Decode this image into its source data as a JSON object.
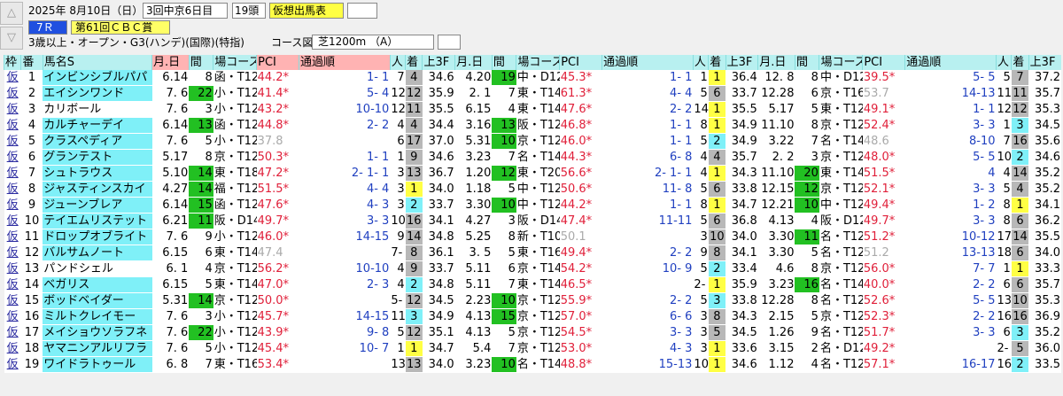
{
  "header": {
    "date": "2025年  8月10日（日）",
    "meeting": "3回中京6日目",
    "heads": "19頭",
    "mode_button": "仮想出馬表",
    "race_no": "7Ｒ",
    "race_title": "第61回ＣＢＣ賞",
    "race_cond": "3歳以上・オープン・G3(ハンデ)(国際)(特指)",
    "course_label": "コース図",
    "course": "芝1200m （A）"
  },
  "columns": {
    "waku": "枠",
    "ban": "番",
    "name": "馬名S",
    "groups": [
      {
        "md": "月.日",
        "kan": "間",
        "jo": "場コース",
        "pci": "PCI",
        "tsuka": "通過順",
        "nin": "人",
        "chaku": "着",
        "agari": "上3F"
      },
      {
        "md": "月.日",
        "kan": "間",
        "jo": "場コース",
        "pci": "PCI",
        "tsuka": "通過順",
        "nin": "人",
        "chaku": "着",
        "agari": "上3F"
      },
      {
        "md": "月.日",
        "kan": "間",
        "jo": "場コース",
        "pci": "PCI",
        "tsuka": "通過順",
        "nin": "人",
        "chaku": "着",
        "agari": "上3F"
      }
    ]
  },
  "rows": [
    {
      "waku": "仮",
      "ban": "1",
      "name": "インビンシブルパパ",
      "r": [
        [
          "6.14",
          "8",
          "函・T12",
          "44.2*",
          "1- 1",
          "7",
          "4",
          "34.6"
        ],
        [
          "4.20",
          "19",
          "中・D12",
          "45.3*",
          "1- 1",
          "1",
          "1",
          "36.4"
        ],
        [
          "12. 8",
          "8",
          "中・D12",
          "39.5*",
          "5- 5",
          "5",
          "7",
          "37.2"
        ]
      ]
    },
    {
      "waku": "仮",
      "ban": "2",
      "name": "エイシンワンド",
      "r": [
        [
          "7. 6",
          "22",
          "小・T12",
          "41.4*",
          "5- 4",
          "12",
          "12",
          "35.9"
        ],
        [
          "2. 1",
          "7",
          "東・T14",
          "61.3*",
          "4- 4",
          "5",
          "6",
          "33.7"
        ],
        [
          "12.28",
          "6",
          "京・T16",
          "53.7",
          "14-13",
          "11",
          "11",
          "35.7"
        ]
      ]
    },
    {
      "waku": "仮",
      "ban": "3",
      "name": "カリボール",
      "r": [
        [
          "7. 6",
          "3",
          "小・T12",
          "43.2*",
          "10-10",
          "12",
          "11",
          "35.5"
        ],
        [
          "6.15",
          "4",
          "東・T14",
          "47.6*",
          "2- 2",
          "14",
          "1",
          "35.5"
        ],
        [
          "5.17",
          "5",
          "東・T12",
          "49.1*",
          "1- 1",
          "12",
          "12",
          "35.3"
        ]
      ]
    },
    {
      "waku": "仮",
      "ban": "4",
      "name": "カルチャーデイ",
      "r": [
        [
          "6.14",
          "13",
          "函・T12",
          "44.8*",
          "2- 2",
          "4",
          "4",
          "34.4"
        ],
        [
          "3.16",
          "13",
          "阪・T12",
          "46.8*",
          "1- 1",
          "8",
          "1",
          "34.9"
        ],
        [
          "11.10",
          "8",
          "京・T12",
          "52.4*",
          "3- 3",
          "1",
          "3",
          "34.5"
        ]
      ]
    },
    {
      "waku": "仮",
      "ban": "5",
      "name": "クラスペディア",
      "r": [
        [
          "7. 6",
          "5",
          "小・T12",
          "37.8",
          "6",
          "17",
          "37.0"
        ],
        [
          "5.31",
          "10",
          "京・T12",
          "46.0*",
          "1- 1",
          "5",
          "2",
          "34.9"
        ],
        [
          "3.22",
          "7",
          "名・T14",
          "48.6",
          "8-10",
          "7",
          "16",
          "35.6"
        ]
      ]
    },
    {
      "waku": "仮",
      "ban": "6",
      "name": "グランテスト",
      "r": [
        [
          "5.17",
          "8",
          "京・T12",
          "50.3*",
          "1- 1",
          "1",
          "9",
          "34.6"
        ],
        [
          "3.23",
          "7",
          "名・T14",
          "44.3*",
          "6- 8",
          "4",
          "4",
          "35.7"
        ],
        [
          "2. 2",
          "3",
          "京・T12",
          "48.0*",
          "5- 5",
          "10",
          "2",
          "34.6"
        ]
      ]
    },
    {
      "waku": "仮",
      "ban": "7",
      "name": "シュトラウス",
      "r": [
        [
          "5.10",
          "14",
          "東・T18",
          "47.2*",
          "2- 1- 1",
          "3",
          "13",
          "36.7"
        ],
        [
          "1.20",
          "12",
          "東・T20",
          "56.6*",
          "2- 1- 1",
          "4",
          "1",
          "34.3"
        ],
        [
          "11.10",
          "20",
          "東・T14",
          "51.5*",
          "4",
          "4",
          "14",
          "35.2"
        ]
      ]
    },
    {
      "waku": "仮",
      "ban": "8",
      "name": "ジャスティンスカイ",
      "r": [
        [
          "4.27",
          "14",
          "福・T12",
          "51.5*",
          "4- 4",
          "3",
          "1",
          "34.0"
        ],
        [
          "1.18",
          "5",
          "中・T12",
          "50.6*",
          "11- 8",
          "5",
          "6",
          "33.8"
        ],
        [
          "12.15",
          "12",
          "京・T12",
          "52.1*",
          "3- 3",
          "5",
          "4",
          "35.2"
        ]
      ]
    },
    {
      "waku": "仮",
      "ban": "9",
      "name": "ジューンブレア",
      "r": [
        [
          "6.14",
          "15",
          "函・T12",
          "47.6*",
          "4- 3",
          "3",
          "2",
          "33.7"
        ],
        [
          "3.30",
          "10",
          "中・T12",
          "44.2*",
          "1- 1",
          "8",
          "1",
          "34.7"
        ],
        [
          "12.21",
          "10",
          "中・T12",
          "49.4*",
          "1- 2",
          "8",
          "1",
          "34.1"
        ]
      ]
    },
    {
      "waku": "仮",
      "ban": "10",
      "name": "テイエムリステット",
      "r": [
        [
          "6.21",
          "11",
          "阪・D14",
          "49.7*",
          "3- 3",
          "10",
          "16",
          "34.1"
        ],
        [
          "4.27",
          "3",
          "阪・D14",
          "47.4*",
          "11-11",
          "5",
          "6",
          "36.8"
        ],
        [
          "4.13",
          "4",
          "阪・D12",
          "49.7*",
          "3- 3",
          "8",
          "6",
          "36.2"
        ]
      ]
    },
    {
      "waku": "仮",
      "ban": "11",
      "name": "ドロップオブライト",
      "r": [
        [
          "7. 6",
          "9",
          "小・T12",
          "46.0*",
          "14-15",
          "9",
          "14",
          "34.8"
        ],
        [
          "5.25",
          "8",
          "新・T10",
          "50.1",
          "3",
          "10",
          "34.0"
        ],
        [
          "3.30",
          "11",
          "名・T12",
          "51.2*",
          "10-12",
          "17",
          "14",
          "35.5"
        ]
      ]
    },
    {
      "waku": "仮",
      "ban": "12",
      "name": "バルサムノート",
      "r": [
        [
          "6.15",
          "6",
          "東・T14",
          "47.4",
          "7- 7",
          "8",
          "36.1"
        ],
        [
          "3. 5",
          "5",
          "東・T16",
          "49.4*",
          "2- 2",
          "9",
          "8",
          "34.1"
        ],
        [
          "3.30",
          "5",
          "名・T12",
          "51.2",
          "13-13",
          "18",
          "6",
          "34.0"
        ]
      ]
    },
    {
      "waku": "仮",
      "ban": "13",
      "name": "パンドシェル",
      "r": [
        [
          "6. 1",
          "4",
          "京・T12",
          "56.2*",
          "10-10",
          "4",
          "9",
          "33.7"
        ],
        [
          "5.11",
          "6",
          "京・T14",
          "54.2*",
          "10- 9",
          "5",
          "2",
          "33.4"
        ],
        [
          "4.6",
          "8",
          "京・T12",
          "56.0*",
          "7- 7",
          "1",
          "1",
          "33.3"
        ]
      ]
    },
    {
      "waku": "仮",
      "ban": "14",
      "name": "ベガリス",
      "r": [
        [
          "6.15",
          "5",
          "東・T14",
          "47.0*",
          "2- 3",
          "4",
          "2",
          "34.8"
        ],
        [
          "5.11",
          "7",
          "東・T14",
          "46.5*",
          "2- 2",
          "1",
          "35.9"
        ],
        [
          "3.23",
          "16",
          "名・T14",
          "40.0*",
          "2- 2",
          "6",
          "6",
          "35.7"
        ]
      ]
    },
    {
      "waku": "仮",
      "ban": "15",
      "name": "ボッドベイダー",
      "r": [
        [
          "5.31",
          "14",
          "京・T12",
          "50.0*",
          "5- 5",
          "12",
          "34.5"
        ],
        [
          "2.23",
          "10",
          "京・T12",
          "55.9*",
          "2- 2",
          "5",
          "3",
          "33.8"
        ],
        [
          "12.28",
          "8",
          "名・T12",
          "52.6*",
          "5- 5",
          "13",
          "10",
          "35.3"
        ]
      ]
    },
    {
      "waku": "仮",
      "ban": "16",
      "name": "ミルトクレイモー",
      "r": [
        [
          "7. 6",
          "3",
          "小・T12",
          "45.7*",
          "14-15",
          "11",
          "3",
          "34.9"
        ],
        [
          "4.13",
          "15",
          "京・T12",
          "57.0*",
          "6- 6",
          "3",
          "8",
          "34.3"
        ],
        [
          "2.15",
          "5",
          "京・T12",
          "52.3*",
          "2- 2",
          "16",
          "16",
          "36.9"
        ]
      ]
    },
    {
      "waku": "仮",
      "ban": "17",
      "name": "メイショウソラフネ",
      "r": [
        [
          "7. 6",
          "22",
          "小・T12",
          "43.9*",
          "9- 8",
          "5",
          "12",
          "35.1"
        ],
        [
          "4.13",
          "5",
          "京・T12",
          "54.5*",
          "3- 3",
          "3",
          "5",
          "34.5"
        ],
        [
          "1.26",
          "9",
          "名・T12",
          "51.7*",
          "3- 3",
          "6",
          "3",
          "35.2"
        ]
      ]
    },
    {
      "waku": "仮",
      "ban": "18",
      "name": "ヤマニンアルリフラ",
      "r": [
        [
          "7. 6",
          "5",
          "小・T12",
          "45.4*",
          "10- 7",
          "1",
          "1",
          "34.7"
        ],
        [
          "5.4",
          "7",
          "京・T12",
          "53.0*",
          "4- 3",
          "3",
          "1",
          "33.6"
        ],
        [
          "3.15",
          "2",
          "名・D12",
          "49.2*",
          "2- 2",
          "5",
          "36.0"
        ]
      ]
    },
    {
      "waku": "仮",
      "ban": "19",
      "name": "ワイドラトゥール",
      "r": [
        [
          "6. 8",
          "7",
          "東・T16",
          "53.4*",
          "13-12",
          "13",
          "34.0"
        ],
        [
          "3.23",
          "10",
          "名・T14",
          "48.8*",
          "15-13",
          "10",
          "1",
          "34.6"
        ],
        [
          "1.12",
          "4",
          "名・T12",
          "57.1*",
          "16-17",
          "16",
          "2",
          "33.5"
        ]
      ]
    }
  ]
}
